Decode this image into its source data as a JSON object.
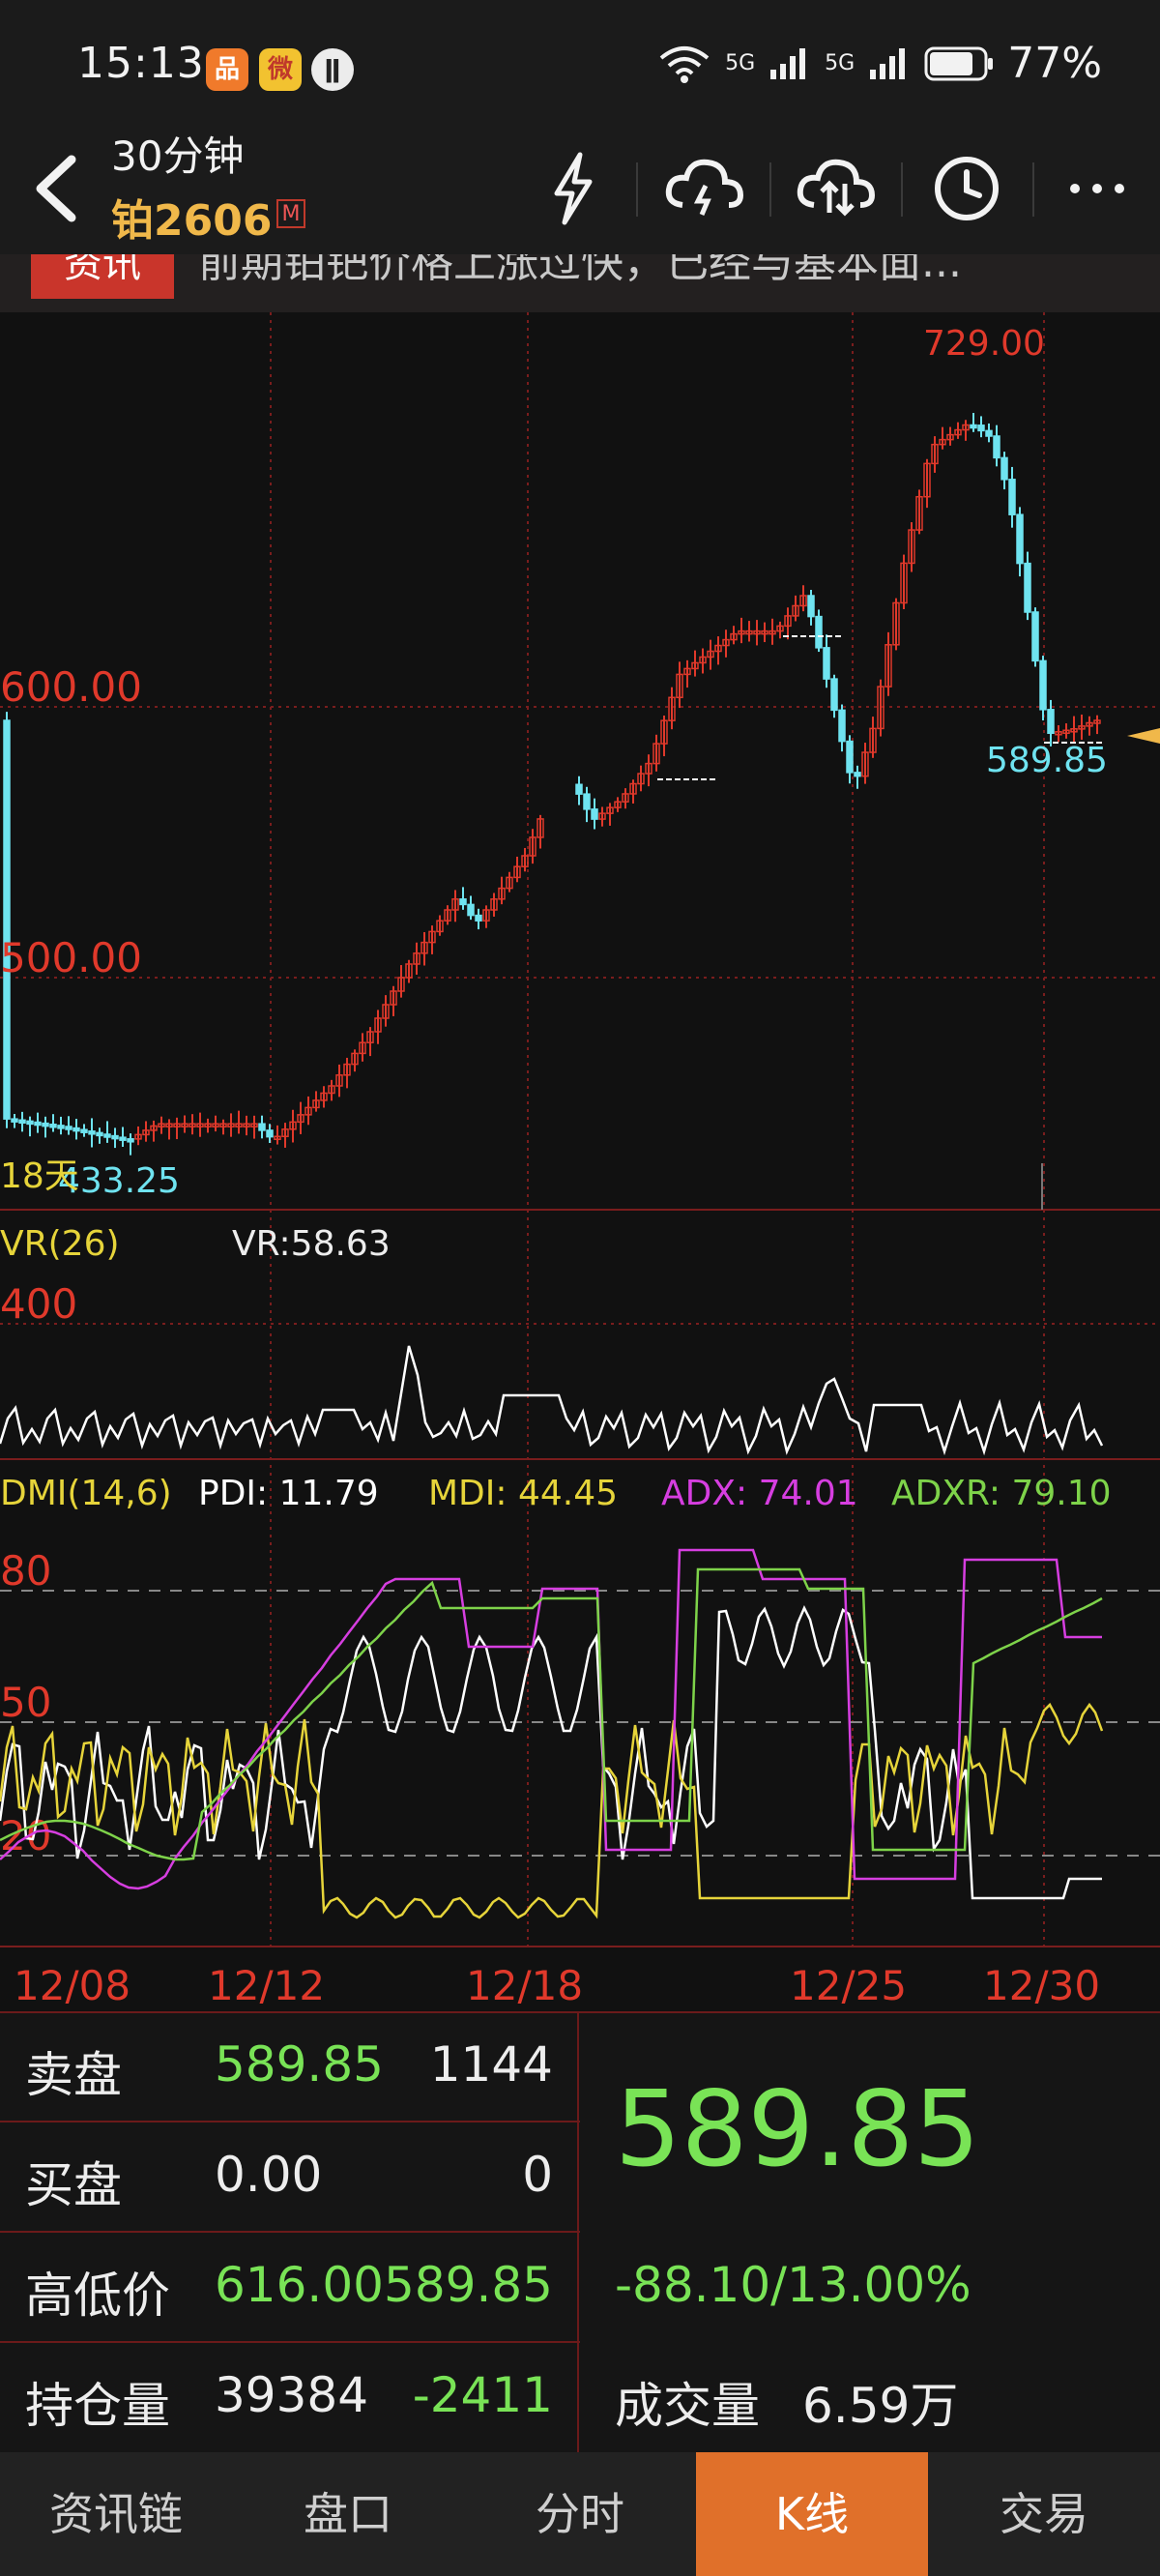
{
  "status_bar": {
    "time": "15:13",
    "battery": "77%",
    "network_1": "5G",
    "network_2": "5G",
    "wifi_label": "6"
  },
  "header": {
    "period": "30分钟",
    "symbol": "铂2606",
    "badge": "M",
    "icons": [
      "lightning-icon",
      "cloud-lightning-icon",
      "cloud-sync-icon",
      "clock-icon",
      "more-icon"
    ]
  },
  "news": {
    "tag": "资讯",
    "text": "前期铂钯价格上涨过快，已经与基本面..."
  },
  "main_chart": {
    "grid_labels": [
      "600.00",
      "500.00"
    ],
    "high_label": "729.00",
    "low_label": "433.25",
    "last_label": "589.85",
    "days_label": "18天"
  },
  "vr_panel": {
    "title": "VR(26)",
    "value_text": "VR:58.63",
    "axis_label": "400"
  },
  "dmi_panel": {
    "title": "DMI(14,6)",
    "pdi": "PDI: 11.79",
    "mdi": "MDI: 44.45",
    "adx": "ADX: 74.01",
    "adxr": "ADXR: 79.10",
    "axis_labels": [
      "80",
      "50",
      "20"
    ]
  },
  "date_axis": [
    "12/08",
    "12/12",
    "12/18",
    "12/25",
    "12/30"
  ],
  "quote": {
    "sell_label": "卖盘",
    "sell_price": "589.85",
    "sell_vol": "1144",
    "buy_label": "买盘",
    "buy_price": "0.00",
    "buy_vol": "0",
    "hilo_label": "高低价",
    "high": "616.00",
    "low": "589.85",
    "oi_label": "持仓量",
    "oi": "39384",
    "oi_change": "-2411",
    "last_price": "589.85",
    "change": "-88.10/13.00%",
    "volume_label": "成交量",
    "volume": "6.59万"
  },
  "nav": [
    "资讯链",
    "盘口",
    "分时",
    "K线",
    "交易"
  ],
  "nav_active": "K线",
  "colors": {
    "up": "#e0392b",
    "down": "#6fe3f0",
    "grid": "#7a1d1d",
    "pdi": "#ffffff",
    "mdi": "#e6d43a",
    "adx": "#d63ee0",
    "adxr": "#7ed34a",
    "accent": "#e0702a"
  }
}
